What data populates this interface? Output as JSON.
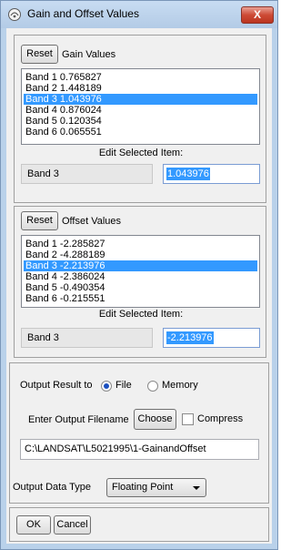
{
  "window": {
    "title": "Gain and Offset Values",
    "close_label": "X"
  },
  "gain": {
    "reset_label": "Reset",
    "header_label": "Gain Values",
    "items": [
      "Band 1 0.765827",
      "Band 2 1.448189",
      "Band 3 1.043976",
      "Band 4 0.876024",
      "Band 5 0.120354",
      "Band 6 0.065551"
    ],
    "selected_index": 2,
    "edit_label": "Edit Selected Item:",
    "selected_name": "Band 3",
    "selected_value": "1.043976"
  },
  "offset": {
    "reset_label": "Reset",
    "header_label": "Offset Values",
    "items": [
      "Band 1 -2.285827",
      "Band 2 -4.288189",
      "Band 3 -2.213976",
      "Band 4 -2.386024",
      "Band 5 -0.490354",
      "Band 6 -0.215551"
    ],
    "selected_index": 2,
    "edit_label": "Edit Selected Item:",
    "selected_name": "Band 3",
    "selected_value": "-2.213976"
  },
  "output": {
    "result_label": "Output Result to",
    "option_file": "File",
    "option_memory": "Memory",
    "selected_option": "File",
    "filename_label": "Enter Output Filename",
    "choose_label": "Choose",
    "compress_label": "Compress",
    "compress_checked": false,
    "filename": "C:\\LANDSAT\\L5021995\\1-GainandOffset",
    "data_type_label": "Output Data Type",
    "data_type_value": "Floating Point"
  },
  "footer": {
    "ok_label": "OK",
    "cancel_label": "Cancel"
  },
  "colors": {
    "selection": "#3399ff",
    "title_bar": "#b9d1ea",
    "close_button": "#cd4a35"
  }
}
